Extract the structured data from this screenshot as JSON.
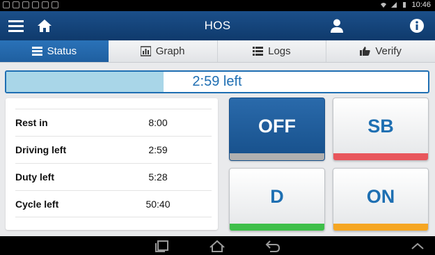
{
  "statusbar": {
    "time": "10:46"
  },
  "header": {
    "title": "HOS"
  },
  "tabs": [
    {
      "label": "Status",
      "icon": "list-icon",
      "active": true
    },
    {
      "label": "Graph",
      "icon": "bar-chart-icon",
      "active": false
    },
    {
      "label": "Logs",
      "icon": "list-icon",
      "active": false
    },
    {
      "label": "Verify",
      "icon": "thumbs-up-icon",
      "active": false
    }
  ],
  "progress": {
    "text": "2:59 left",
    "fraction": 0.373,
    "fill_color": "#a9d6e8",
    "border_color": "#1f6fb3"
  },
  "summary": [
    {
      "label": "Rest in",
      "value": "8:00"
    },
    {
      "label": "Driving left",
      "value": "2:59"
    },
    {
      "label": "Duty left",
      "value": "5:28"
    },
    {
      "label": "Cycle left",
      "value": "50:40"
    }
  ],
  "duty_buttons": [
    {
      "label": "OFF",
      "color": "#b0b0b0",
      "active": true
    },
    {
      "label": "SB",
      "color": "#e8565c",
      "active": false
    },
    {
      "label": "D",
      "color": "#3fbf4a",
      "active": false
    },
    {
      "label": "ON",
      "color": "#f5a623",
      "active": false
    }
  ],
  "colors": {
    "accent": "#1f6fb3",
    "header": "#1b4f8a"
  }
}
